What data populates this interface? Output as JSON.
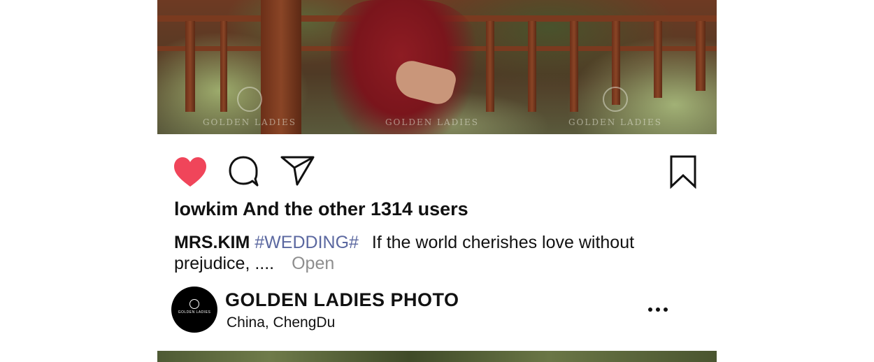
{
  "post": {
    "photo_watermark": "GOLDEN LADIES",
    "likes_text": "lowkim And the other 1314 users",
    "caption": {
      "author": "MRS.KIM",
      "hashtag": "#WEDDING#",
      "text": "If the world cherishes love without prejudice, ....",
      "open_label": "Open"
    },
    "account": {
      "name": "GOLDEN LADIES PHOTO",
      "location": "China,  ChengDu",
      "avatar_text": "GOLDEN LADIES"
    }
  },
  "icons": {
    "like": "heart-icon",
    "comment": "comment-icon",
    "share": "send-icon",
    "save": "bookmark-icon",
    "more": "more-options-icon"
  },
  "colors": {
    "like_active": "#f0455a",
    "hashtag": "#5b68a0",
    "muted": "#8e8e8e"
  }
}
